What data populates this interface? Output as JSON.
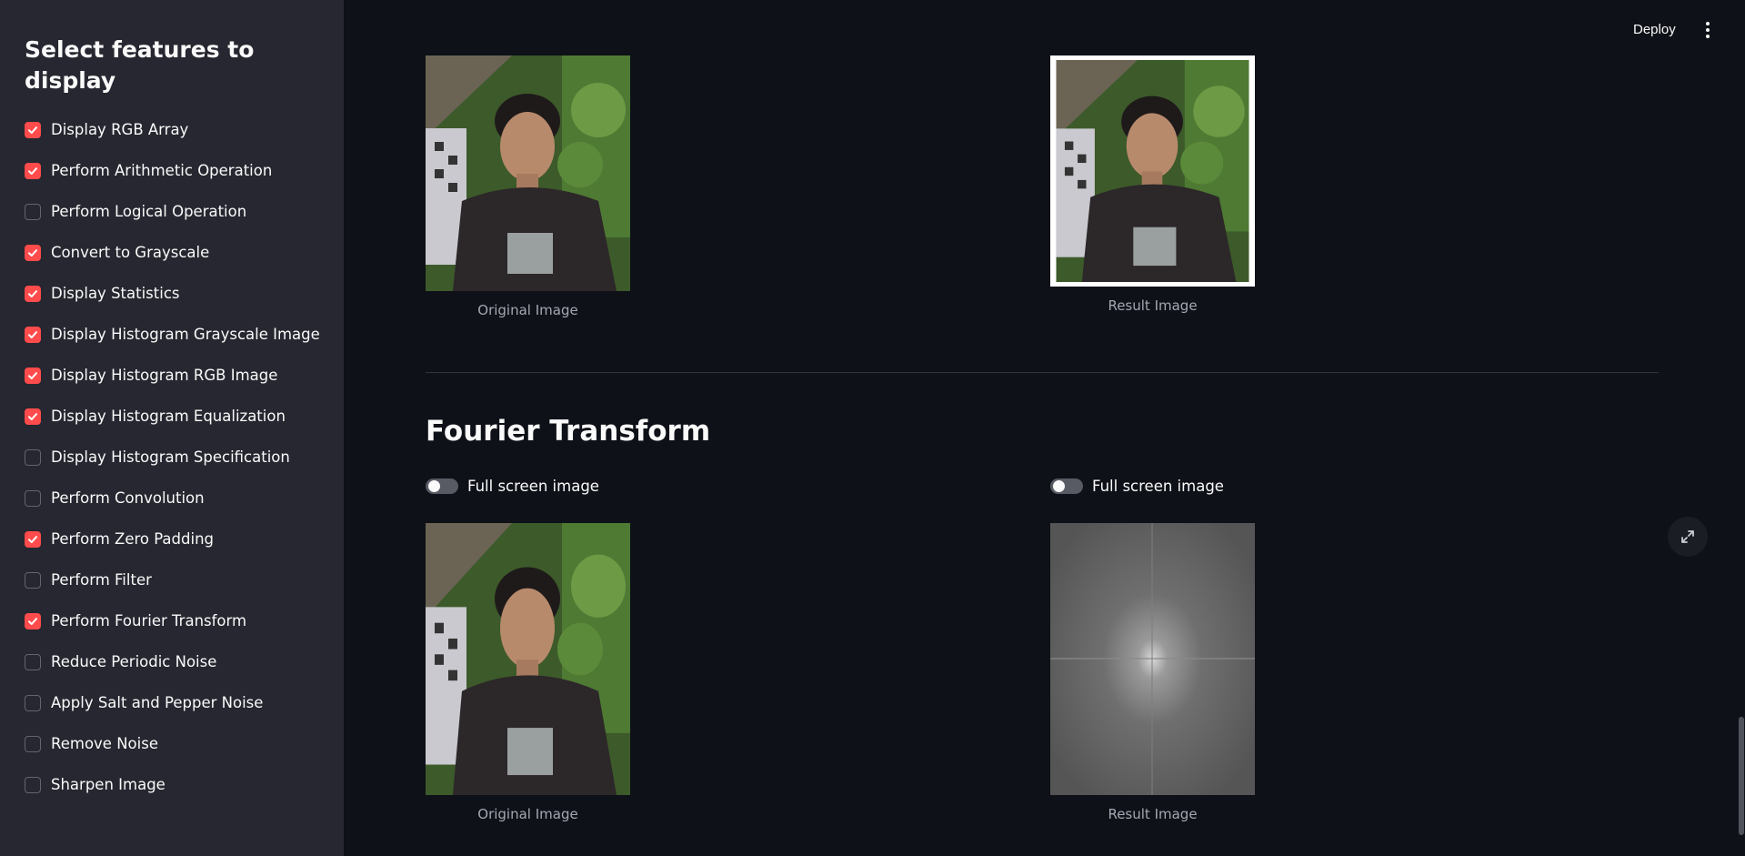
{
  "sidebar": {
    "title": "Select features to display",
    "items": [
      {
        "label": "Display RGB Array",
        "checked": true
      },
      {
        "label": "Perform Arithmetic Operation",
        "checked": true
      },
      {
        "label": "Perform Logical Operation",
        "checked": false
      },
      {
        "label": "Convert to Grayscale",
        "checked": true
      },
      {
        "label": "Display Statistics",
        "checked": true
      },
      {
        "label": "Display Histogram Grayscale Image",
        "checked": true
      },
      {
        "label": "Display Histogram RGB Image",
        "checked": true
      },
      {
        "label": "Display Histogram Equalization",
        "checked": true
      },
      {
        "label": "Display Histogram Specification",
        "checked": false
      },
      {
        "label": "Perform Convolution",
        "checked": false
      },
      {
        "label": "Perform Zero Padding",
        "checked": true
      },
      {
        "label": "Perform Filter",
        "checked": false
      },
      {
        "label": "Perform Fourier Transform",
        "checked": true
      },
      {
        "label": "Reduce Periodic Noise",
        "checked": false
      },
      {
        "label": "Apply Salt and Pepper Noise",
        "checked": false
      },
      {
        "label": "Remove Noise",
        "checked": false
      },
      {
        "label": "Sharpen Image",
        "checked": false
      }
    ]
  },
  "header": {
    "deploy_label": "Deploy"
  },
  "zero_padding": {
    "original_caption": "Original Image",
    "result_caption": "Result Image"
  },
  "fourier": {
    "title": "Fourier Transform",
    "toggle_left_label": "Full screen image",
    "toggle_right_label": "Full screen image",
    "original_caption": "Original Image",
    "result_caption": "Result Image"
  },
  "colors": {
    "accent": "#ff4b4b",
    "background": "#0e1117",
    "sidebar": "#262730",
    "caption": "#a3a8b4"
  },
  "icons": {
    "checkbox_tick": "check-icon",
    "menu": "vertical-dots-icon",
    "expand": "expand-arrows-icon"
  }
}
